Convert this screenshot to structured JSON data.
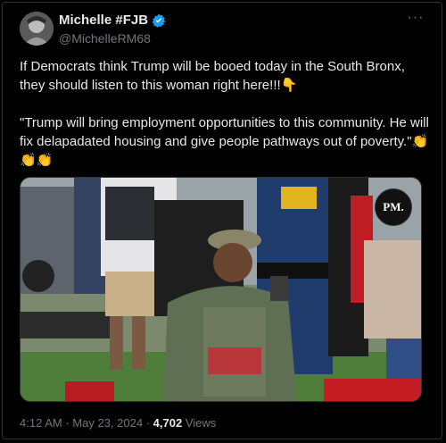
{
  "author": {
    "display_name": "Michelle #FJB",
    "handle": "@MichelleRM68",
    "verified_color": "#1d9bf0"
  },
  "tweet": {
    "paragraph1": "If Democrats think Trump will be booed today in the South Bronx, they should listen to this woman right here!!!👇",
    "paragraph2": "\"Trump will bring employment opportunities to this community. He will fix delapadated housing and give people pathways out of poverty.\"👏👏👏"
  },
  "media": {
    "watermark": "PM."
  },
  "footer": {
    "time": "4:12 AM",
    "separator": "·",
    "date": "May 23, 2024",
    "views_count": "4,702",
    "views_label": "Views"
  },
  "icons": [
    "verified-badge-icon",
    "more-options-icon"
  ]
}
